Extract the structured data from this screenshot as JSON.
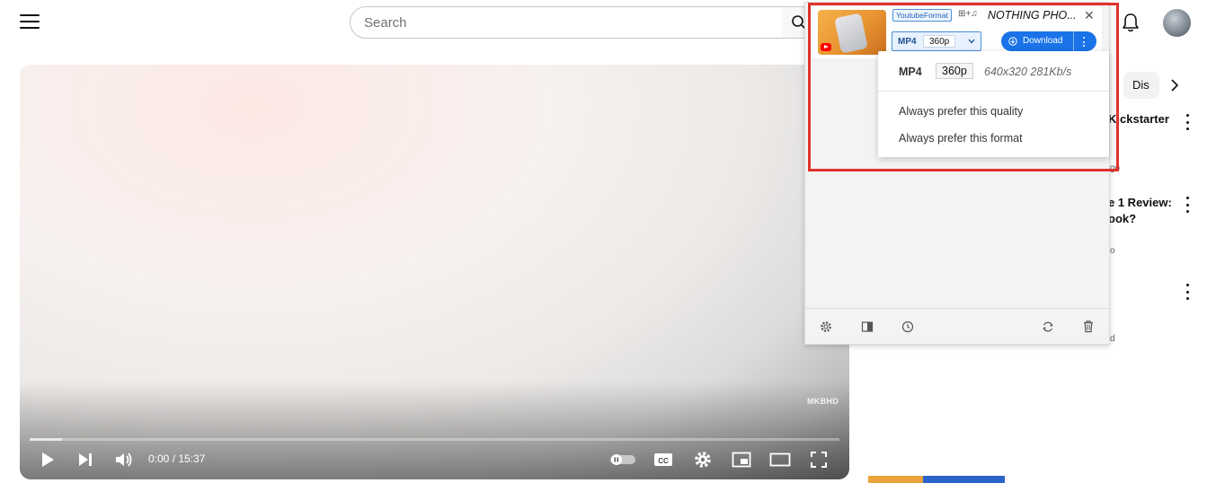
{
  "header": {
    "search_placeholder": "Search",
    "menu_icon": "hamburger-menu-icon",
    "search_icon": "search-icon",
    "notifications_icon": "bell-icon",
    "avatar": "user-avatar"
  },
  "player": {
    "watermark": "MKBHD",
    "current_time": "0:00",
    "duration": "15:37",
    "time_display": "0:00 / 15:37",
    "buffered_fraction": 0.04
  },
  "sidebar": {
    "chip_label": "Dis",
    "related": [
      {
        "title_fragment": "Kickstarter",
        "meta_fragment": "go"
      },
      {
        "title_line1": "e 1 Review:",
        "title_line2": "ook?",
        "meta_fragment": "o"
      },
      {
        "meta_fragment": "d"
      }
    ]
  },
  "extension": {
    "format_tag": "YoutubeFormat",
    "media_icons": "⊞+♫",
    "video_title": "NOTHING PHO...",
    "selected_format": "MP4",
    "selected_quality": "360p",
    "download_label": "Download",
    "dropdown": {
      "format": "MP4",
      "quality": "360p",
      "details": "640x320 281Kb/s",
      "option_prefer_quality": "Always prefer this quality",
      "option_prefer_format": "Always prefer this format"
    },
    "footer_icons": [
      "gear-icon",
      "sidebar-panel-icon",
      "history-clock-icon",
      "refresh-icon",
      "trash-icon"
    ],
    "highlight_color": "#e0322b",
    "accent_color": "#1a73e8"
  }
}
